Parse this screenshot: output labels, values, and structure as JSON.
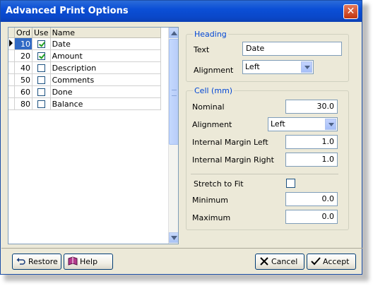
{
  "window": {
    "title": "Advanced Print Options",
    "close_glyph": "✕"
  },
  "grid": {
    "columns": {
      "ord": "Ord",
      "use": "Use",
      "name": "Name"
    },
    "rows": [
      {
        "ord": "10",
        "use": true,
        "name": "Date",
        "selected": true
      },
      {
        "ord": "20",
        "use": true,
        "name": "Amount"
      },
      {
        "ord": "40",
        "use": false,
        "name": "Description"
      },
      {
        "ord": "50",
        "use": false,
        "name": "Comments"
      },
      {
        "ord": "60",
        "use": false,
        "name": "Done"
      },
      {
        "ord": "80",
        "use": false,
        "name": "Balance"
      }
    ]
  },
  "heading": {
    "legend": "Heading",
    "text_label": "Text",
    "text_value": "Date",
    "alignment_label": "Alignment",
    "alignment_value": "Left"
  },
  "cell": {
    "legend": "Cell (mm)",
    "nominal_label": "Nominal",
    "nominal_value": "30.0",
    "alignment_label": "Alignment",
    "alignment_value": "Left",
    "margin_left_label": "Internal Margin Left",
    "margin_left_value": "1.0",
    "margin_right_label": "Internal Margin Right",
    "margin_right_value": "1.0",
    "stretch_label": "Stretch to Fit",
    "stretch_checked": false,
    "minimum_label": "Minimum",
    "minimum_value": "0.0",
    "maximum_label": "Maximum",
    "maximum_value": "0.0"
  },
  "buttons": {
    "restore": "Restore",
    "help": "Help",
    "cancel": "Cancel",
    "accept": "Accept"
  },
  "icons": {
    "restore": "undo-arrow-icon",
    "help": "book-icon",
    "cancel": "x-icon",
    "accept": "checkmark-icon"
  },
  "colors": {
    "title_bar": "#0b4fd6",
    "selection": "#316ac5",
    "legend_text": "#0046d5",
    "window_bg": "#ece9d8"
  }
}
